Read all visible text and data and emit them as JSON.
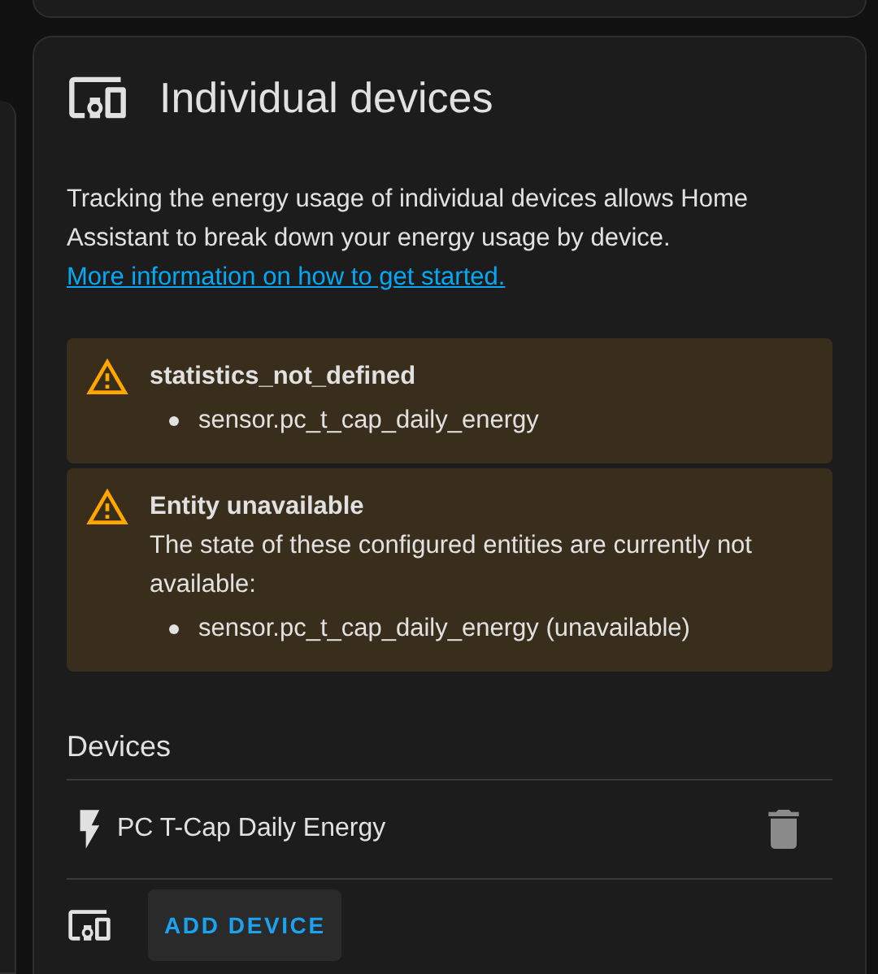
{
  "card": {
    "title": "Individual devices",
    "description": "Tracking the energy usage of individual devices allows Home Assistant to break down your energy usage by device.",
    "link": "More information on how to get started."
  },
  "alerts": [
    {
      "kind": "warning",
      "title": "statistics_not_defined",
      "items": [
        "sensor.pc_t_cap_daily_energy"
      ]
    },
    {
      "kind": "warning",
      "title": "Entity unavailable",
      "message": "The state of these configured entities are currently not available:",
      "items": [
        "sensor.pc_t_cap_daily_energy (unavailable)"
      ]
    }
  ],
  "devices_heading": "Devices",
  "devices": [
    {
      "name": "PC T-Cap Daily Energy"
    }
  ],
  "add_button": "ADD DEVICE"
}
